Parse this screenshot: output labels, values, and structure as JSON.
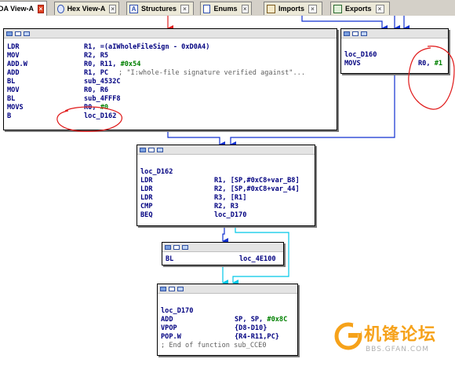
{
  "tabs": [
    {
      "label": "DA View-A",
      "active": true
    },
    {
      "label": "Hex View-A",
      "active": false
    },
    {
      "label": "Structures",
      "active": false
    },
    {
      "label": "Enums",
      "active": false
    },
    {
      "label": "Imports",
      "active": false
    },
    {
      "label": "Exports",
      "active": false
    }
  ],
  "blocks": {
    "main": {
      "lines": [
        {
          "mn": "LDR",
          "op": "R1, =(aIWholeFileSign - 0xD0A4)",
          "cm": ""
        },
        {
          "mn": "MOV",
          "op": "R2, R5",
          "cm": ""
        },
        {
          "mn": "ADD.W",
          "op": "R0, R11, #0x54",
          "cm": ""
        },
        {
          "mn": "ADD",
          "op": "R1, PC",
          "cm": "; \"I:whole-file signature verified against\"..."
        },
        {
          "mn": "BL",
          "op": "sub_4532C",
          "cm": ""
        },
        {
          "mn": "MOV",
          "op": "R0, R6",
          "cm": ""
        },
        {
          "mn": "BL",
          "op": "sub_4FFF8",
          "cm": ""
        },
        {
          "mn": "MOVS",
          "op": "R0, #0",
          "cm": ""
        },
        {
          "mn": "B",
          "op": "loc_D162",
          "cm": ""
        }
      ]
    },
    "d160": {
      "label": "loc_D160",
      "lines": [
        {
          "mn": "MOVS",
          "op": "R0, #1"
        }
      ]
    },
    "d162": {
      "label": "loc_D162",
      "lines": [
        {
          "mn": "LDR",
          "op": "R1, [SP,#0xC8+var_B8]"
        },
        {
          "mn": "LDR",
          "op": "R2, [SP,#0xC8+var_44]"
        },
        {
          "mn": "LDR",
          "op": "R3, [R1]"
        },
        {
          "mn": "CMP",
          "op": "R2, R3"
        },
        {
          "mn": "BEQ",
          "op": "loc_D170"
        }
      ]
    },
    "call": {
      "lines": [
        {
          "mn": "BL",
          "op": "loc_4E100"
        }
      ]
    },
    "d170": {
      "label": "loc_D170",
      "lines": [
        {
          "mn": "ADD",
          "op": "SP, SP, #0x8C"
        },
        {
          "mn": "VPOP",
          "op": "{D8-D10}"
        },
        {
          "mn": "POP.W",
          "op": "{R4-R11,PC}"
        }
      ],
      "footer": "; End of function sub_CCE0"
    }
  },
  "watermark": {
    "text": "机锋论坛",
    "url": "BBS.GFAN.COM"
  },
  "colors": {
    "edge_blue": "#1030d0",
    "edge_cyan": "#00c8e8",
    "edge_red": "#e02020",
    "annotation": "#e01818",
    "mnemonic": "#000080",
    "immediate": "#008000",
    "comment": "#606060",
    "watermark": "#f6a21a"
  }
}
